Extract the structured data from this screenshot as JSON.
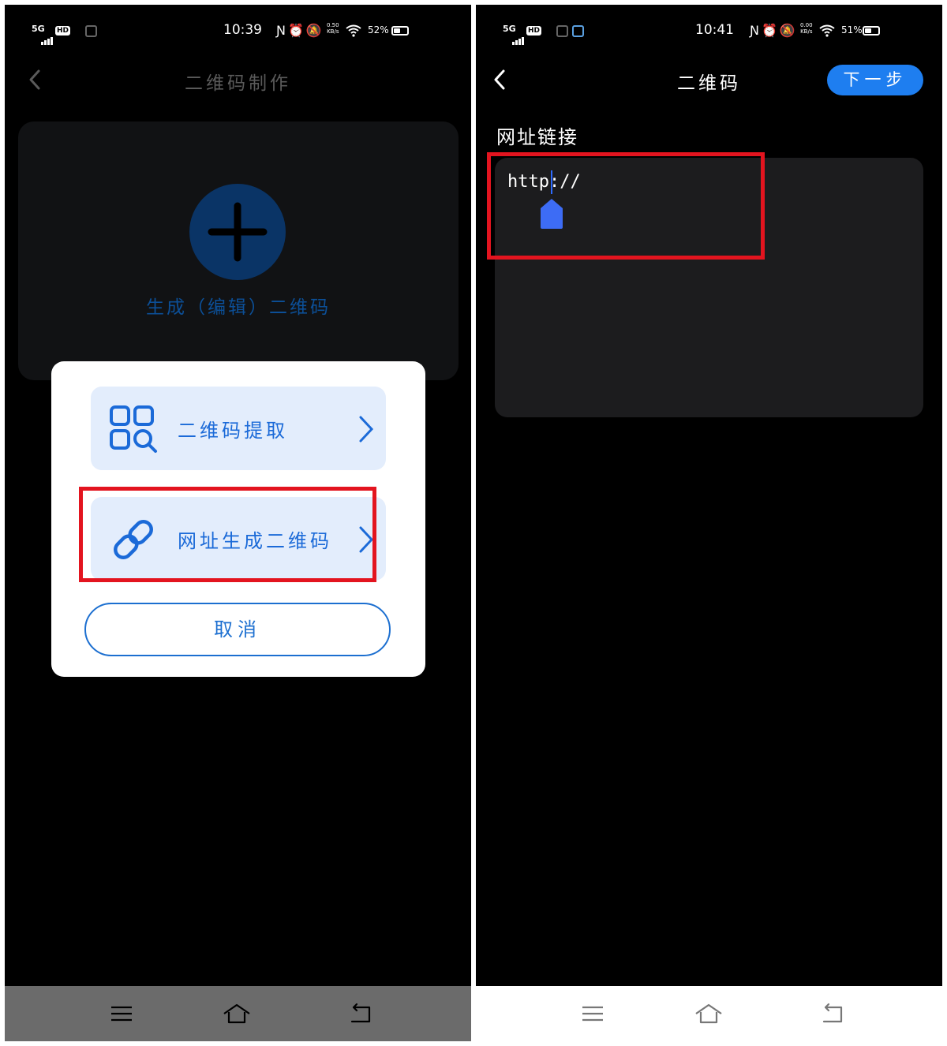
{
  "left_screen": {
    "status": {
      "network": "5G",
      "hd": "HD",
      "time": "10:39",
      "speed_top": "0.50",
      "speed_bottom": "KB/s",
      "battery": "52%",
      "battery_level": 0.52
    },
    "header": {
      "title": "二维码制作"
    },
    "generate_card": {
      "label": "生成（编辑）二维码"
    },
    "dialog": {
      "options": [
        {
          "label": "二维码提取",
          "icon": "qr-scan-icon"
        },
        {
          "label": "网址生成二维码",
          "icon": "link-icon"
        }
      ],
      "cancel_label": "取消"
    },
    "nav": [
      "menu-icon",
      "home-icon",
      "back-icon"
    ]
  },
  "right_screen": {
    "status": {
      "network": "5G",
      "hd": "HD",
      "time": "10:41",
      "speed_top": "0.00",
      "speed_bottom": "KB/s",
      "battery": "51%",
      "battery_level": 0.51
    },
    "header": {
      "title": "二维码",
      "next_label": "下一步"
    },
    "section_label": "网址链接",
    "url_input": {
      "value": "http://"
    },
    "nav": [
      "menu-icon",
      "home-icon",
      "back-icon"
    ]
  },
  "colors": {
    "accent": "#1e7ef0",
    "highlight": "#e3141f",
    "dialog_option_bg": "#e3edfc"
  }
}
